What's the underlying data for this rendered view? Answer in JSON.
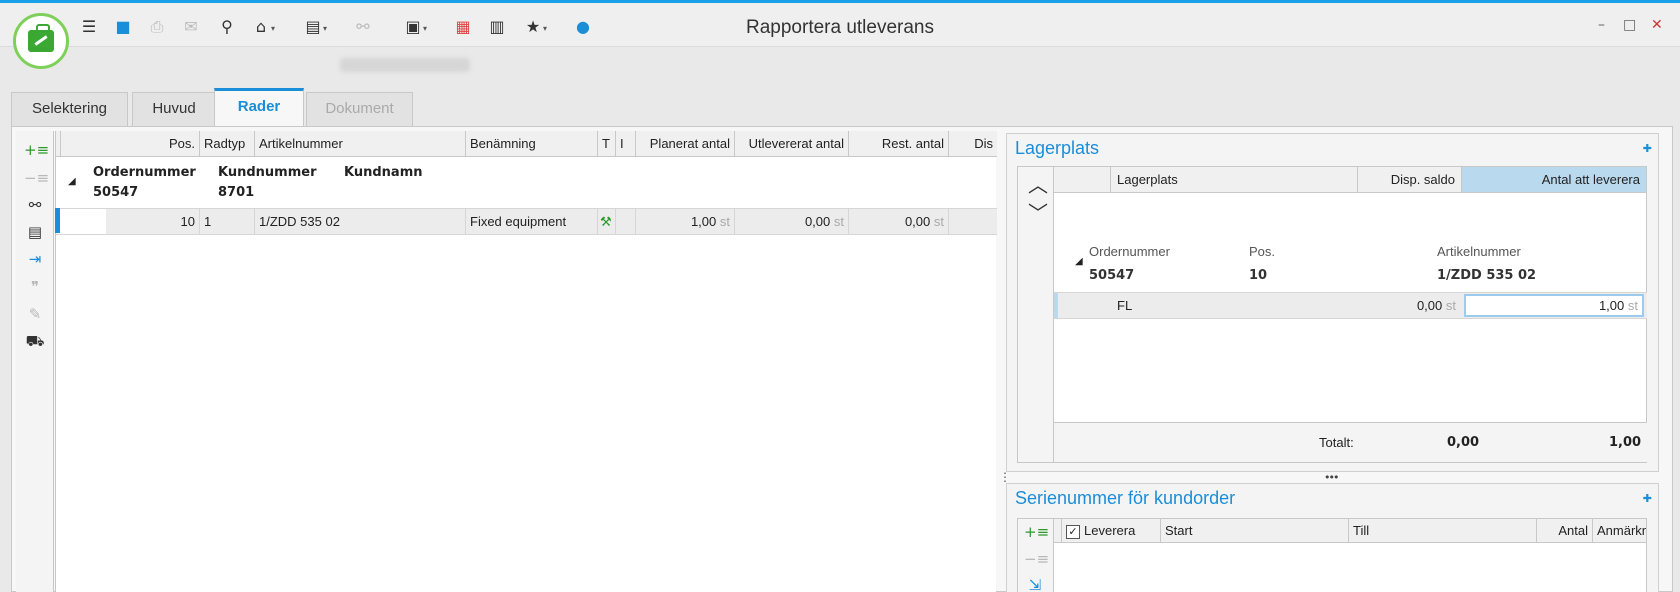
{
  "window": {
    "title": "Rapportera utleverans",
    "controls": {
      "minimize": "–",
      "maximize": "□",
      "close": "✕"
    }
  },
  "toolbar": {
    "icons": [
      "list-icon",
      "save-icon",
      "print-icon",
      "mail-icon",
      "search-icon",
      "home-icon",
      "calculator-icon",
      "link-icon",
      "layout-icon",
      "apps-grid-icon",
      "book-icon",
      "star-icon",
      "help-icon"
    ]
  },
  "tabs": [
    {
      "label": "Selektering",
      "state": "normal"
    },
    {
      "label": "Huvud",
      "state": "normal"
    },
    {
      "label": "Rader",
      "state": "active"
    },
    {
      "label": "Dokument",
      "state": "disabled"
    }
  ],
  "side_tools": {
    "icons": [
      "add-row-icon",
      "remove-row-icon",
      "link-icon",
      "copy-icon",
      "move-icon",
      "quote-add-icon",
      "edit-pen-icon",
      "truck-icon"
    ]
  },
  "grid": {
    "columns": {
      "pos": "Pos.",
      "radtyp": "Radtyp",
      "artikelnummer": "Artikelnummer",
      "benamning": "Benämning",
      "t": "T",
      "i": "I",
      "planerat": "Planerat antal",
      "utlevererat": "Utlevererat antal",
      "rest": "Rest. antal",
      "dis": "Dis"
    },
    "group": {
      "ordernummer_label": "Ordernummer",
      "ordernummer": "50547",
      "kundnummer_label": "Kundnummer",
      "kundnummer": "8701",
      "kundnamn_label": "Kundnamn"
    },
    "row": {
      "pos": "10",
      "radtyp": "1",
      "artikelnummer": "1/ZDD 535 02",
      "benamning": "Fixed equipment",
      "planerat": "1,00",
      "utlevererat": "0,00",
      "rest": "0,00",
      "unit": "st"
    }
  },
  "lagerplats": {
    "title": "Lagerplats",
    "columns": {
      "lagerplats": "Lagerplats",
      "disp_saldo": "Disp. saldo",
      "antal": "Antal att leverera"
    },
    "group": {
      "ordernummer_label": "Ordernummer",
      "ordernummer": "50547",
      "pos_label": "Pos.",
      "pos": "10",
      "artikelnummer_label": "Artikelnummer",
      "artikelnummer": "1/ZDD 535 02"
    },
    "row": {
      "lagerplats": "FL",
      "disp_saldo": "0,00",
      "antal": "1,00",
      "unit": "st"
    },
    "totals": {
      "label": "Totalt:",
      "disp_saldo": "0,00",
      "antal": "1,00"
    }
  },
  "serienummer": {
    "title": "Serienummer för kundorder",
    "columns": {
      "leverera": "Leverera",
      "start": "Start",
      "till": "Till",
      "antal": "Antal",
      "anmarkning": "Anmärkn"
    },
    "leverera_checked": true
  }
}
